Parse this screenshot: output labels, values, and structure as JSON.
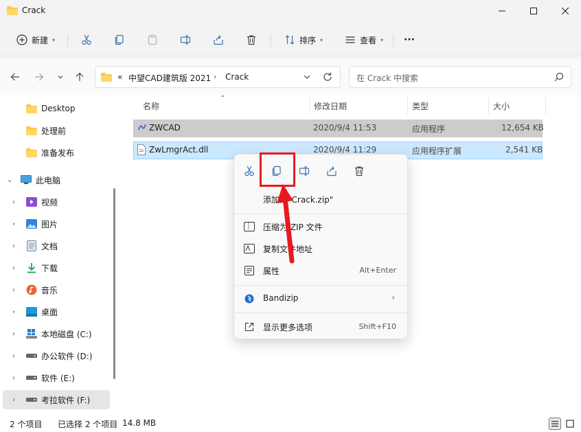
{
  "window": {
    "title": "Crack"
  },
  "toolbar": {
    "new_label": "新建",
    "sort_label": "排序",
    "view_label": "查看",
    "more_label": "···"
  },
  "address": {
    "overflow": "«",
    "segments": [
      "中望CAD建筑版 2021",
      "Crack"
    ]
  },
  "search": {
    "placeholder": "在 Crack 中搜索"
  },
  "sidebar": {
    "items": [
      {
        "label": "Desktop",
        "icon": "folder-icon"
      },
      {
        "label": "处理前",
        "icon": "folder-icon"
      },
      {
        "label": "准备发布",
        "icon": "folder-icon"
      },
      {
        "label": "此电脑",
        "icon": "monitor-icon"
      },
      {
        "label": "视频",
        "icon": "video-icon"
      },
      {
        "label": "图片",
        "icon": "picture-icon"
      },
      {
        "label": "文档",
        "icon": "document-icon"
      },
      {
        "label": "下载",
        "icon": "download-icon"
      },
      {
        "label": "音乐",
        "icon": "music-icon"
      },
      {
        "label": "桌面",
        "icon": "desktop-icon"
      },
      {
        "label": "本地磁盘 (C:)",
        "icon": "drive-icon"
      },
      {
        "label": "办公软件 (D:)",
        "icon": "drive-icon"
      },
      {
        "label": "软件 (E:)",
        "icon": "drive-icon"
      },
      {
        "label": "考拉软件 (F:)",
        "icon": "drive-icon"
      }
    ]
  },
  "columns": {
    "name": "名称",
    "modified": "修改日期",
    "type": "类型",
    "size": "大小"
  },
  "files": [
    {
      "name": "ZWCAD",
      "modified": "2020/9/4 11:53",
      "type": "应用程序",
      "size": "12,654 KB"
    },
    {
      "name": "ZwLmgrAct.dll",
      "modified": "2020/9/4 11:29",
      "type": "应用程序扩展",
      "size": "2,541 KB"
    }
  ],
  "status": {
    "count": "2 个项目",
    "selected": "已选择 2 个项目",
    "size": "14.8 MB"
  },
  "context_menu": {
    "add_to_zip": "添加到\"Crack.zip\"",
    "compress_zip": "压缩为 ZIP 文件",
    "copy_path": "复制文件地址",
    "properties": "属性",
    "properties_shortcut": "Alt+Enter",
    "bandizip": "Bandizip",
    "more_options": "显示更多选项",
    "more_shortcut": "Shift+F10"
  },
  "colors": {
    "highlight_box": "#e8191f",
    "selection": "#cce8ff",
    "folder": "#f8c94b"
  }
}
